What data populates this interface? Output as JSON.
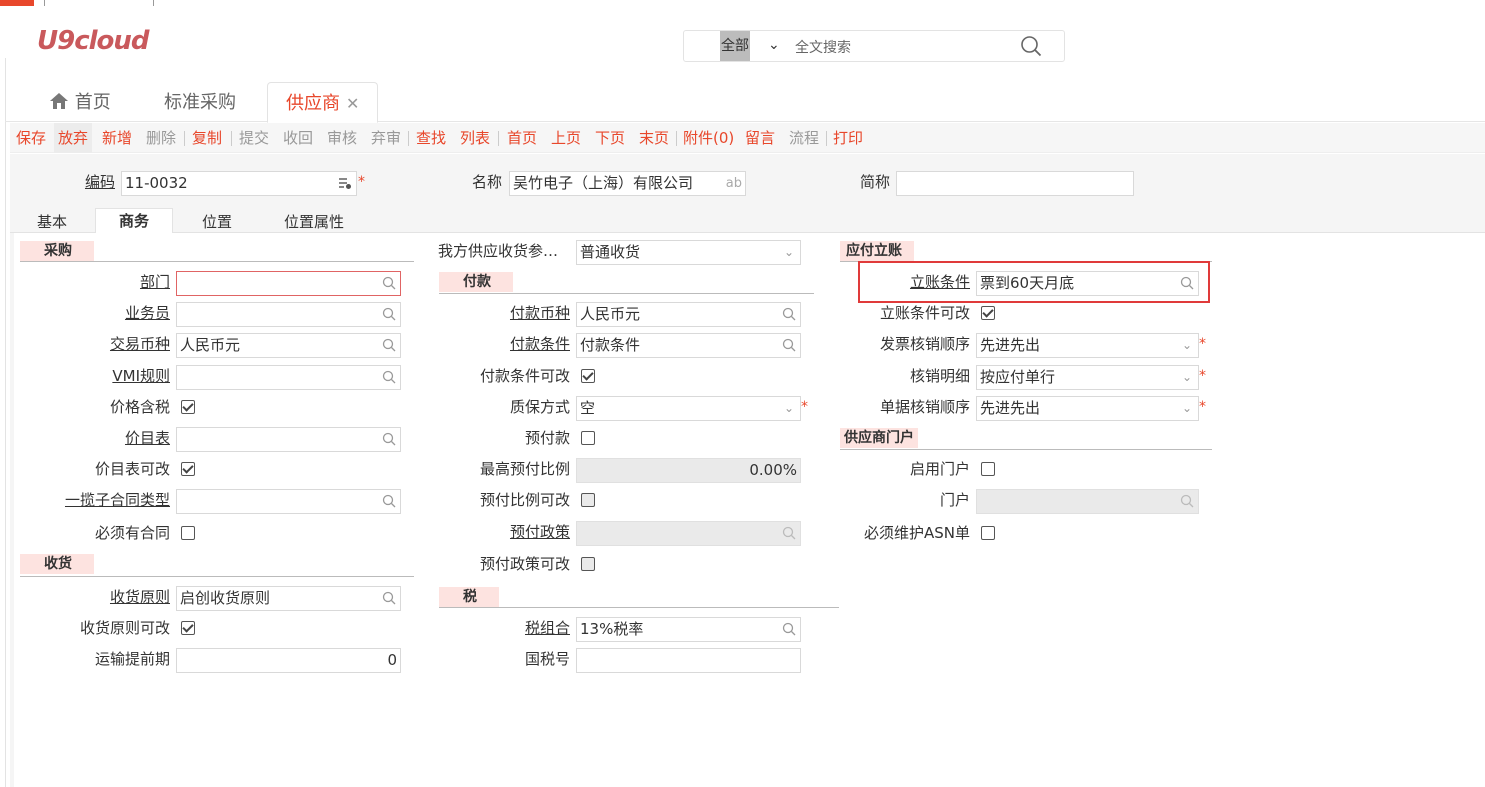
{
  "logo": "U9cloud",
  "search": {
    "scope": "全部",
    "placeholder": "全文搜索"
  },
  "tabs": [
    {
      "label": "首页"
    },
    {
      "label": "标准采购"
    },
    {
      "label": "供应商"
    }
  ],
  "toolbar": [
    "保存",
    "放弃",
    "新增",
    "删除",
    "复制",
    "提交",
    "收回",
    "审核",
    "弃审",
    "查找",
    "列表",
    "首页",
    "上页",
    "下页",
    "末页",
    "附件(0)",
    "留言",
    "流程",
    "打印"
  ],
  "header": {
    "code_label": "编码",
    "code_value": "11-0032",
    "name_label": "名称",
    "name_value": "吴竹电子（上海）有限公司",
    "name_suffix": "ab",
    "abbr_label": "简称",
    "abbr_value": ""
  },
  "inner_tabs": [
    "基本",
    "商务",
    "位置",
    "位置属性"
  ],
  "purchase": {
    "title": "采购",
    "dept": "部门",
    "buyer": "业务员",
    "currency": "交易币种",
    "currency_value": "人民币元",
    "vmi": "VMI规则",
    "price_tax": "价格含税",
    "pricelist": "价目表",
    "pricelist_edit": "价目表可改",
    "sub_contract": "一揽子合同类型",
    "must_contract": "必须有合同"
  },
  "receive": {
    "title": "收货",
    "rule": "收货原则",
    "rule_value": "启创收货原则",
    "rule_edit": "收货原则可改",
    "lead": "运输提前期",
    "lead_value": "0"
  },
  "supply": {
    "label": "我方供应收货参…",
    "value": "普通收货"
  },
  "payment": {
    "title": "付款",
    "currency": "付款币种",
    "currency_value": "人民币元",
    "term": "付款条件",
    "term_value": "付款条件",
    "term_edit": "付款条件可改",
    "warranty": "质保方式",
    "warranty_value": "空",
    "prepay": "预付款",
    "max_ratio": "最高预付比例",
    "max_ratio_value": "0.00%",
    "ratio_edit": "预付比例可改",
    "policy": "预付政策",
    "policy_edit": "预付政策可改"
  },
  "tax": {
    "title": "税",
    "group": "税组合",
    "group_value": "13%税率",
    "taxno": "国税号"
  },
  "ap": {
    "title": "应付立账",
    "cond": "立账条件",
    "cond_value": "票到60天月底",
    "cond_edit": "立账条件可改",
    "inv_order": "发票核销顺序",
    "inv_order_value": "先进先出",
    "detail": "核销明细",
    "detail_value": "按应付单行",
    "doc_order": "单据核销顺序",
    "doc_order_value": "先进先出"
  },
  "portal": {
    "title": "供应商门户",
    "enable": "启用门户",
    "portal": "门户",
    "asn": "必须维护ASN单"
  },
  "colors": {
    "accent": "#e8472b",
    "section_bg": "#fde3e0",
    "highlight": "#e03a3a"
  }
}
